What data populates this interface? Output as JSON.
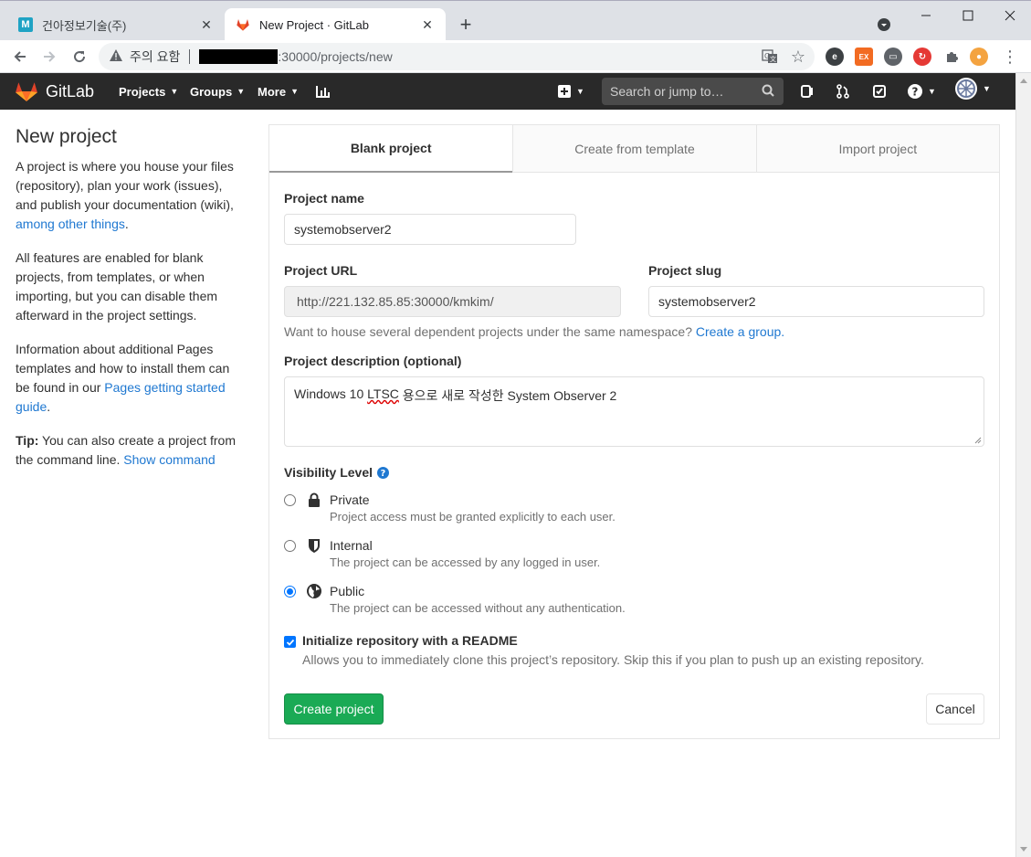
{
  "browser": {
    "tabs": [
      {
        "title": "건아정보기술(주)",
        "favicon": "m-icon",
        "active": false
      },
      {
        "title": "New Project · GitLab",
        "favicon": "gitlab-fox-icon",
        "active": true
      }
    ],
    "security_label": "주의 요함",
    "url_suffix": ":30000/projects/new"
  },
  "navbar": {
    "brand": "GitLab",
    "menus": [
      "Projects",
      "Groups",
      "More"
    ],
    "search_placeholder": "Search or jump to…"
  },
  "sidebar": {
    "title": "New project",
    "para1_text": "A project is where you house your files (repository), plan your work (issues), and publish your documentation (wiki),",
    "para1_link": "among other things",
    "para1_end": ".",
    "para2": "All features are enabled for blank projects, from templates, or when importing, but you can disable them afterward in the project settings.",
    "para3_text": "Information about additional Pages templates and how to install them can be found in our",
    "para3_link": "Pages getting started guide",
    "para3_end": ".",
    "tip_label": "Tip:",
    "tip_text": "You can also create a project from the command line.",
    "tip_link": "Show command"
  },
  "form": {
    "tabs": [
      "Blank project",
      "Create from template",
      "Import project"
    ],
    "project_name_label": "Project name",
    "project_name_value": "systemobserver2",
    "project_url_label": "Project URL",
    "project_url_value": "http://221.132.85.85:30000/kmkim/",
    "project_slug_label": "Project slug",
    "project_slug_value": "systemobserver2",
    "namespace_help": "Want to house several dependent projects under the same namespace?",
    "namespace_link": "Create a group.",
    "description_label": "Project description (optional)",
    "description_value_pre": "Windows 10 ",
    "description_value_spell": "LTSC",
    "description_value_post": " 용으로 새로 작성한 System Observer 2",
    "visibility_label": "Visibility Level",
    "visibility": [
      {
        "title": "Private",
        "desc": "Project access must be granted explicitly to each user.",
        "icon": "lock-icon",
        "selected": false
      },
      {
        "title": "Internal",
        "desc": "The project can be accessed by any logged in user.",
        "icon": "shield-icon",
        "selected": false
      },
      {
        "title": "Public",
        "desc": "The project can be accessed without any authentication.",
        "icon": "globe-icon",
        "selected": true
      }
    ],
    "readme_label": "Initialize repository with a README",
    "readme_desc": "Allows you to immediately clone this project’s repository. Skip this if you plan to push up an existing repository.",
    "readme_checked": true,
    "create_button": "Create project",
    "cancel_button": "Cancel"
  },
  "colors": {
    "navbar_bg": "#292929",
    "link": "#1f78d1",
    "create_button": "#1aaa55",
    "radio_checked": "#0075ff"
  }
}
